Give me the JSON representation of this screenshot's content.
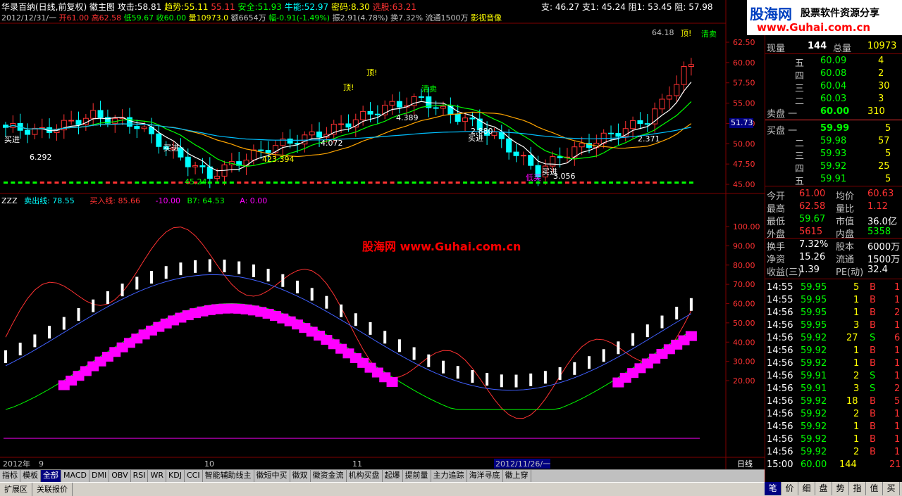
{
  "header": {
    "stock_name": "华录百纳(日线,前复权)",
    "main_chart_label": "徽主图",
    "attack_label": "攻击:",
    "attack_value": "58.81",
    "trend_label": "趋势:",
    "trend_value": "55.11",
    "extra1_value": "55.11",
    "safe_label": "安全:",
    "safe_value": "51.93",
    "bull_label": "牛能:",
    "bull_value": "52.97",
    "code_label": "密码:",
    "code_value": "8.30",
    "select_label": "选股:",
    "select_value": "63.21",
    "support_text": "支: 46.27  支1: 45.24  阻1: 53.45  阻: 57.98",
    "line2": "2012/12/31/一",
    "open_label": "开61.00",
    "high_label": "高62.58",
    "low_label": "低59.67",
    "close_label": "收60.00",
    "vol_label": "量10973.0",
    "amount_label": "额6654万",
    "change_label": "幅-0.91(-1.49%)",
    "swing_label": "振2.91(4.78%)",
    "turnover_label": "换7.32%",
    "float_label": "流通1500万",
    "sector_label": "影视音像"
  },
  "logo": {
    "title": "股海网",
    "subtitle": "股票软件资源分享",
    "url": "www.Guhai.com.cn"
  },
  "watermark": {
    "text": "股海网 www.Guhai.com.cn"
  },
  "main_axis": {
    "ticks": [
      "62.50",
      "60.00",
      "57.50",
      "55.00",
      "52.50",
      "50.00",
      "47.50",
      "45.00"
    ],
    "marker": "51.73",
    "top_right": "64.18"
  },
  "sub_header": {
    "name": "ZZZ",
    "sell_label": "卖出线: 78.55",
    "buy_label": "买入线: 85.66",
    "c_label": "-10.00",
    "b7_label": "B7: 64.53",
    "a_label": "A: 0.00"
  },
  "sub_axis": {
    "ticks": [
      "100.00",
      "90.00",
      "80.00",
      "70.00",
      "60.00",
      "50.00",
      "40.00",
      "30.00",
      "20.00"
    ]
  },
  "annotations": {
    "top1": "顶!",
    "top2": "顶!",
    "top3": "顶!",
    "sell1": "清卖",
    "sell2": "清卖",
    "buy1": "买进",
    "buy2": "买进",
    "buy3": "买进",
    "buy4": "买进",
    "low_buy": "低买",
    "p1": "6.292",
    "p2": "45.24",
    "p3": "423.394",
    "p4": "4.072",
    "p5": "4.389",
    "p6": "2.880",
    "p7": "3.056",
    "p8": "2.371"
  },
  "time_axis": {
    "labels": [
      "2012年",
      "9",
      "10",
      "11",
      "2012/11/26/一"
    ],
    "period": "日线"
  },
  "quote": {
    "now_label": "现量",
    "now_value": "144",
    "total_label": "总量",
    "total_value": "10973",
    "sell_levels": [
      {
        "label": "五",
        "price": "60.09",
        "vol": "4"
      },
      {
        "label": "四",
        "price": "60.08",
        "vol": "2"
      },
      {
        "label": "三",
        "price": "60.04",
        "vol": "30"
      },
      {
        "label": "二",
        "price": "60.03",
        "vol": "3"
      },
      {
        "label": "卖盘 一",
        "price": "60.00",
        "vol": "310"
      }
    ],
    "buy_levels": [
      {
        "label": "买盘 一",
        "price": "59.99",
        "vol": "5"
      },
      {
        "label": "二",
        "price": "59.98",
        "vol": "57"
      },
      {
        "label": "三",
        "price": "59.93",
        "vol": "5"
      },
      {
        "label": "四",
        "price": "59.92",
        "vol": "25"
      },
      {
        "label": "五",
        "price": "59.91",
        "vol": "5"
      }
    ],
    "stats": [
      {
        "l1": "今开",
        "v1": "61.00",
        "l2": "均价",
        "v2": "60.63"
      },
      {
        "l1": "最高",
        "v1": "62.58",
        "l2": "量比",
        "v2": "1.12"
      },
      {
        "l1": "最低",
        "v1": "59.67",
        "l2": "市值",
        "v2": "36.0亿"
      },
      {
        "l1": "外盘",
        "v1": "5615",
        "l2": "内盘",
        "v2": "5358"
      },
      {
        "l1": "换手",
        "v1": "7.32%",
        "l2": "股本",
        "v2": "6000万"
      },
      {
        "l1": "净资",
        "v1": "15.26",
        "l2": "流通",
        "v2": "1500万"
      },
      {
        "l1": "收益(三)",
        "v1": "1.39",
        "l2": "PE(动)",
        "v2": "32.4"
      }
    ],
    "ticks": [
      {
        "t": "14:55",
        "p": "59.95",
        "v": "5",
        "s": "B",
        "n": "1"
      },
      {
        "t": "14:55",
        "p": "59.95",
        "v": "1",
        "s": "B",
        "n": "1"
      },
      {
        "t": "14:56",
        "p": "59.95",
        "v": "1",
        "s": "B",
        "n": "2"
      },
      {
        "t": "14:56",
        "p": "59.95",
        "v": "3",
        "s": "B",
        "n": "1"
      },
      {
        "t": "14:56",
        "p": "59.92",
        "v": "27",
        "s": "S",
        "n": "6"
      },
      {
        "t": "14:56",
        "p": "59.92",
        "v": "1",
        "s": "B",
        "n": "1"
      },
      {
        "t": "14:56",
        "p": "59.92",
        "v": "1",
        "s": "B",
        "n": "1"
      },
      {
        "t": "14:56",
        "p": "59.91",
        "v": "2",
        "s": "S",
        "n": "1"
      },
      {
        "t": "14:56",
        "p": "59.91",
        "v": "3",
        "s": "S",
        "n": "2"
      },
      {
        "t": "14:56",
        "p": "59.92",
        "v": "18",
        "s": "B",
        "n": "5"
      },
      {
        "t": "14:56",
        "p": "59.92",
        "v": "2",
        "s": "B",
        "n": "1"
      },
      {
        "t": "14:56",
        "p": "59.92",
        "v": "1",
        "s": "B",
        "n": "1"
      },
      {
        "t": "14:56",
        "p": "59.92",
        "v": "1",
        "s": "B",
        "n": "1"
      },
      {
        "t": "14:56",
        "p": "59.92",
        "v": "2",
        "s": "B",
        "n": "1"
      },
      {
        "t": "15:00",
        "p": "60.00",
        "v": "144",
        "s": "",
        "n": "21"
      }
    ]
  },
  "bottom_tabs": [
    "指标",
    "模板",
    "全部",
    "MACD",
    "DMI",
    "OBV",
    "RSI",
    "WR",
    "KDJ",
    "CCI",
    "智能辅助线主",
    "徽短中买",
    "徽双",
    "徽资金流",
    "机构买盘",
    "起爆",
    "提前量",
    "主力追踪",
    "海洋寻底",
    "徽上穿"
  ],
  "status_items": [
    "扩展区",
    "关联报价"
  ],
  "right_tabs": [
    "笔",
    "价",
    "细",
    "盘",
    "势",
    "指",
    "值",
    "买"
  ],
  "colors": {
    "up": "#ff3232",
    "down": "#00ffff",
    "green": "#00ff00",
    "yellow": "#ffff00",
    "magenta": "#ff00ff",
    "accent": "#000080"
  }
}
